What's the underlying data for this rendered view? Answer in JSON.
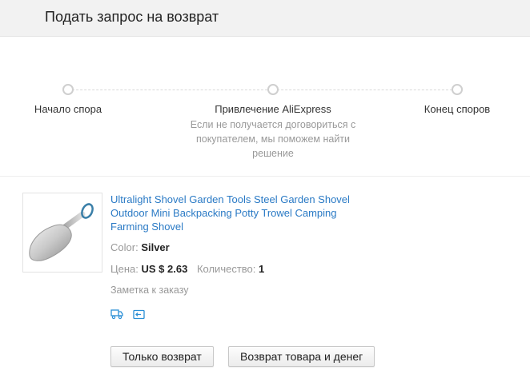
{
  "header": {
    "title": "Подать запрос на возврат"
  },
  "progress": {
    "steps": [
      {
        "label": "Начало спора"
      },
      {
        "label": "Привлечение AliExpress",
        "description": "Если не получается договориться с покупателем, мы поможем найти решение"
      },
      {
        "label": "Конец споров"
      }
    ]
  },
  "product": {
    "title": "Ultralight Shovel Garden Tools Steel Garden Shovel Outdoor Mini Backpacking Potty Trowel Camping Farming Shovel",
    "color_label": "Color:",
    "color_value": "Silver",
    "price_label": "Цена:",
    "price_value": "US $ 2.63",
    "quantity_label": "Количество:",
    "quantity_value": "1",
    "order_note": "Заметка к заказу",
    "icons": [
      "delivery-truck-icon",
      "return-card-icon"
    ]
  },
  "actions": {
    "refund_only": "Только возврат",
    "return_and_refund": "Возврат товара и денег"
  },
  "colors": {
    "link": "#2a7ac5",
    "icon": "#2a8fd6",
    "muted": "#999999"
  }
}
